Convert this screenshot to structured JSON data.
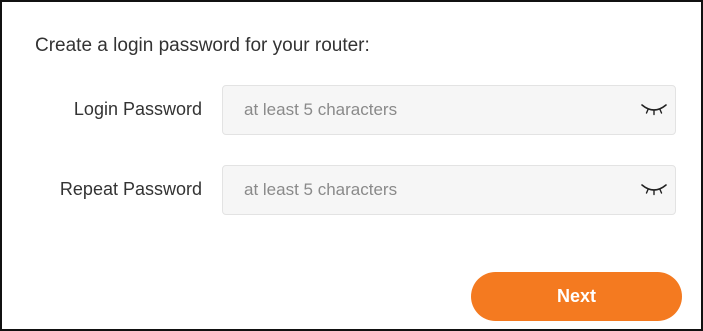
{
  "form": {
    "heading": "Create a login password for your router:",
    "fields": [
      {
        "label": "Login Password",
        "placeholder": "at least 5 characters",
        "value": "",
        "icon": "eye-closed-icon"
      },
      {
        "label": "Repeat Password",
        "placeholder": "at least 5 characters",
        "value": "",
        "icon": "eye-closed-icon"
      }
    ],
    "next_label": "Next"
  },
  "colors": {
    "accent": "#f47a20",
    "field_background": "#f6f6f6",
    "field_border": "#e3e3e3",
    "text": "#333333",
    "placeholder": "#8a8a8a",
    "frame_border": "#111111"
  }
}
